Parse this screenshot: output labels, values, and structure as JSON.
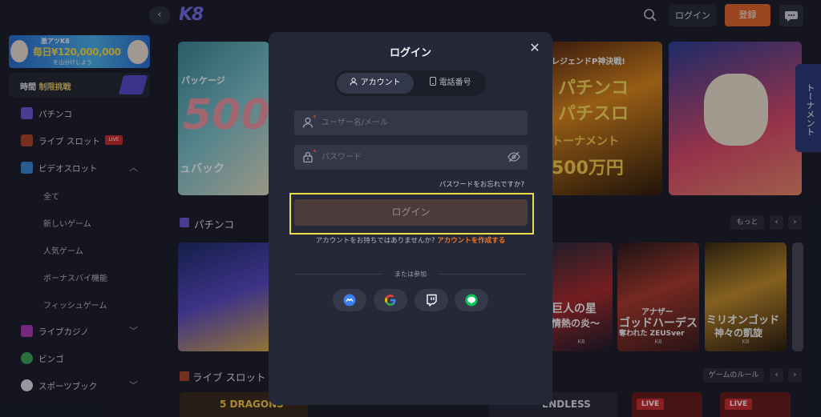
{
  "header": {
    "collapse_icon": "chevron-left",
    "logo": "K8",
    "login_label": "ログイン",
    "register_label": "登録"
  },
  "sidebar": {
    "promo": {
      "line1": "激アツK8",
      "line2": "毎日¥120,000,000",
      "line3": "を山分けしよう"
    },
    "challenge": {
      "label_white": "時間 ",
      "label_yellow": "制限挑戦"
    },
    "items": [
      {
        "label": "パチンコ",
        "icon": "pachinko-icon"
      },
      {
        "label": "ライブ スロット",
        "icon": "live-slot-icon",
        "badge": "LIVE"
      },
      {
        "label": "ビデオスロット",
        "icon": "video-slot-icon",
        "expanded": true
      },
      {
        "label": "全て"
      },
      {
        "label": "新しいゲーム"
      },
      {
        "label": "人気ゲーム"
      },
      {
        "label": "ボーナスバイ機能"
      },
      {
        "label": "フィッシュゲーム"
      },
      {
        "label": "ライブカジノ",
        "icon": "live-casino-icon"
      },
      {
        "label": "ビンゴ",
        "icon": "bingo-icon"
      },
      {
        "label": "スポーツブック",
        "icon": "sportsbook-icon"
      }
    ]
  },
  "banners": {
    "b1": {
      "t1": "パッケージ",
      "t2": "500",
      "t3": "ュバック"
    },
    "b2": {
      "t1": "レジェンドP神決戦!",
      "t2": "パチンコ",
      "t3": "パチスロ",
      "t4": "トーナメント",
      "t5": "500万円"
    }
  },
  "tournament_tab": "トーナメント",
  "sections": {
    "pachinko": {
      "title": "パチンコ",
      "more": "もっと"
    },
    "live_slot": {
      "title": "ライブ スロット",
      "rules": "ゲームのルール"
    }
  },
  "tiles": [
    {
      "t1": "巨人の星",
      "t2": "情熱の炎〜",
      "t3": "K8"
    },
    {
      "t1": "ゴッドハーデス",
      "t2": "奪われた ZEUSver",
      "t3": "K8",
      "t0": "アナザー"
    },
    {
      "t1": "ミリオンゴッド",
      "t2": "神々の凱旋",
      "t3": "K8"
    }
  ],
  "bottom_tiles": {
    "dragons": "5 DRAGONS",
    "endless": "ENDLESS",
    "live1": "LIVE",
    "live2": "LIVE"
  },
  "modal": {
    "title": "ログイン",
    "tabs": {
      "account": "アカウント",
      "phone": "電話番号"
    },
    "username_placeholder": "ユーザー名/メール",
    "password_placeholder": "パスワード",
    "forgot": "パスワードをお忘れですか?",
    "submit": "ログイン",
    "no_account": "アカウントをお持ちではありませんか? ",
    "create_account": "アカウントを作成する",
    "or_join": "または参加",
    "socials": [
      "metamask-icon",
      "google-icon",
      "twitch-icon",
      "line-icon"
    ]
  },
  "colors": {
    "accent": "#e8672a",
    "brand": "#7d6cf0",
    "highlight": "#e6e046"
  }
}
